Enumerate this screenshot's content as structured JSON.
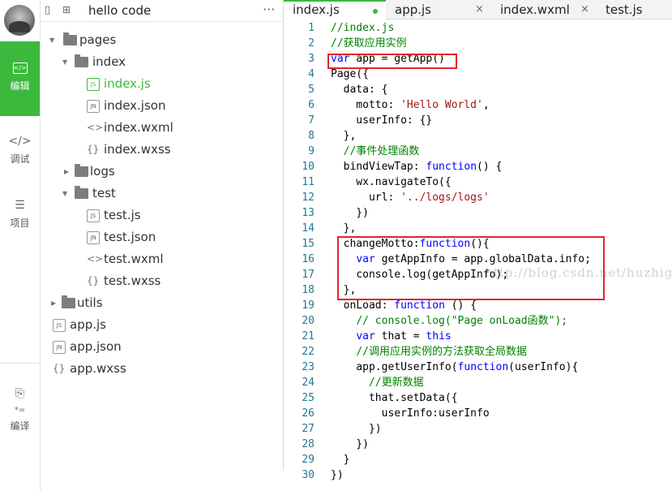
{
  "rail": {
    "items": [
      {
        "label": "编辑",
        "icon": "code-box-icon",
        "active": true
      },
      {
        "label": "调试",
        "icon": "code-brackets-icon",
        "active": false
      },
      {
        "label": "项目",
        "icon": "menu-lines-icon",
        "active": false
      },
      {
        "label": "编译",
        "icon": "compile-icon",
        "active": false
      }
    ]
  },
  "tree": {
    "title": "hello code",
    "more": "···",
    "items": [
      {
        "name": "pages",
        "type": "folder",
        "expanded": true
      },
      {
        "name": "index",
        "type": "folder",
        "expanded": true
      },
      {
        "name": "index.js",
        "type": "js",
        "badge": "JS",
        "active": true
      },
      {
        "name": "index.json",
        "type": "json",
        "badge": "JN"
      },
      {
        "name": "index.wxml",
        "type": "wxml",
        "badge": "<>"
      },
      {
        "name": "index.wxss",
        "type": "wxss",
        "badge": "{}"
      },
      {
        "name": "logs",
        "type": "folder",
        "expanded": false
      },
      {
        "name": "test",
        "type": "folder",
        "expanded": true
      },
      {
        "name": "test.js",
        "type": "js",
        "badge": "JS"
      },
      {
        "name": "test.json",
        "type": "json",
        "badge": "JN"
      },
      {
        "name": "test.wxml",
        "type": "wxml",
        "badge": "<>"
      },
      {
        "name": "test.wxss",
        "type": "wxss",
        "badge": "{}"
      },
      {
        "name": "utils",
        "type": "folder",
        "expanded": false
      },
      {
        "name": "app.js",
        "type": "js",
        "badge": "JS"
      },
      {
        "name": "app.json",
        "type": "json",
        "badge": "JN"
      },
      {
        "name": "app.wxss",
        "type": "wxss",
        "badge": "{}"
      }
    ]
  },
  "tabs": [
    {
      "label": "index.js",
      "active": true,
      "modified": true
    },
    {
      "label": "app.js",
      "close": "×"
    },
    {
      "label": "index.wxml",
      "close": "×"
    },
    {
      "label": "test.js"
    }
  ],
  "editor": {
    "watermark": "http://blog.csdn.net/huzhigenlaohu  uyang",
    "lines": [
      "//index.js",
      "//获取应用实例",
      "var app = getApp()",
      "Page({",
      "  data: {",
      "    motto: 'Hello World',",
      "    userInfo: {}",
      "  },",
      "  //事件处理函数",
      "  bindViewTap: function() {",
      "    wx.navigateTo({",
      "      url: '../logs/logs'",
      "    })",
      "  },",
      "  changeMotto:function(){",
      "    var getAppInfo = app.globalData.info;",
      "    console.log(getAppInfo);",
      "  },",
      "  onLoad: function () {",
      "    // console.log(\"Page onLoad函数\");",
      "    var that = this",
      "    //调用应用实例的方法获取全局数据",
      "    app.getUserInfo(function(userInfo){",
      "      //更新数据",
      "      that.setData({",
      "        userInfo:userInfo",
      "      })",
      "    })",
      "  }",
      "})"
    ],
    "highlight_color": "#e0262b"
  },
  "colors": {
    "accent": "#3cb93c",
    "keyword": "#0000ff",
    "comment": "#008000",
    "string": "#a31515",
    "line_number": "#237893"
  }
}
